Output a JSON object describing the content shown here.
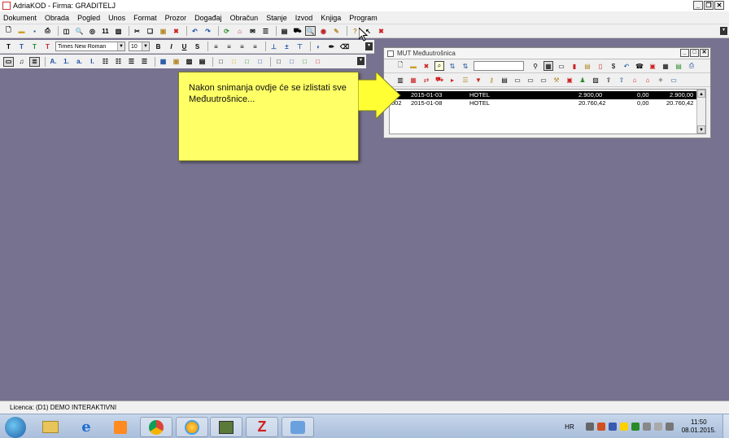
{
  "window": {
    "title": "AdriaKOD - Firma: GRADITELJ"
  },
  "menu": [
    "Dokument",
    "Obrada",
    "Pogled",
    "Unos",
    "Format",
    "Prozor",
    "Događaj",
    "Obračun",
    "Stanje",
    "Izvod",
    "Knjiga",
    "Program"
  ],
  "format_bar": {
    "text_buttons": [
      "T",
      "T",
      "T",
      "T"
    ],
    "font_name": "Times New Roman",
    "font_size": "10",
    "style_buttons": [
      "B",
      "I",
      "U",
      "S"
    ]
  },
  "mdi_window": {
    "title": "MUT Međuutrošnica",
    "rows": [
      {
        "id": "1",
        "date": "2015-01-03",
        "name": "HOTEL",
        "amount": "2.900,00",
        "tax": "0,00",
        "total": "2.900,00"
      },
      {
        "id": "002",
        "date": "2015-01-08",
        "name": "HOTEL",
        "amount": "20.760,42",
        "tax": "0,00",
        "total": "20.760,42"
      }
    ]
  },
  "callout": {
    "text": "Nakon snimanja ovdje će se izlistati sve Međuutrošnice..."
  },
  "status": {
    "licence": "Licenca: (D1) DEMO INTERAKTIVNI"
  },
  "taskbar": {
    "lang": "HR",
    "time": "11:50",
    "date": "08.01.2015."
  }
}
